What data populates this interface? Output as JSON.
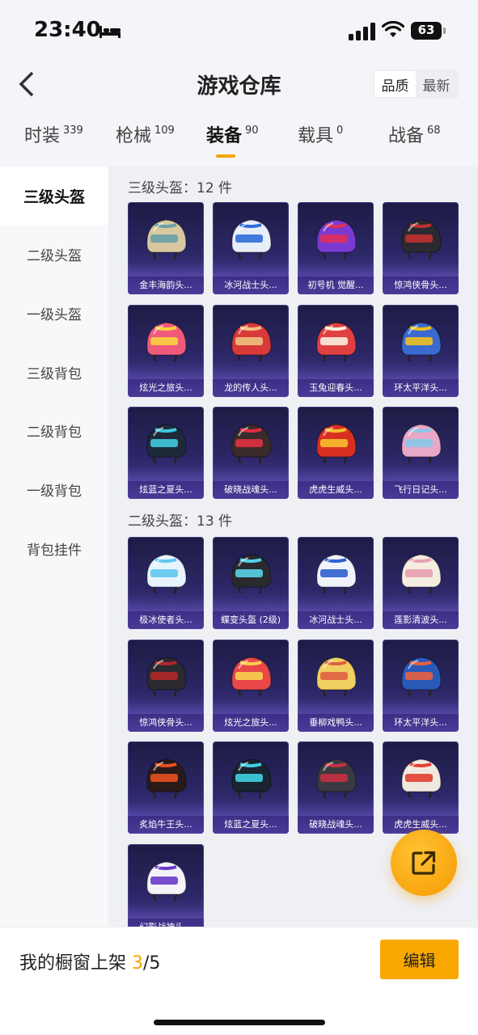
{
  "status": {
    "time": "23:40",
    "battery": "63"
  },
  "header": {
    "title": "游戏仓库",
    "sort_options": [
      "品质",
      "最新"
    ],
    "sort_active": 0
  },
  "tabs": [
    {
      "label": "时装",
      "count": "339"
    },
    {
      "label": "枪械",
      "count": "109"
    },
    {
      "label": "装备",
      "count": "90"
    },
    {
      "label": "载具",
      "count": "0"
    },
    {
      "label": "战备",
      "count": "68"
    }
  ],
  "active_tab": 2,
  "sidebar": [
    "三级头盔",
    "二级头盔",
    "一级头盔",
    "三级背包",
    "二级背包",
    "一级背包",
    "背包挂件"
  ],
  "sidebar_active": 0,
  "sections": [
    {
      "title": "三级头盔：12 件",
      "items": [
        {
          "name": "金丰海韵头...",
          "icon": "helmet-icon",
          "color": "#d8c8a0",
          "accent": "#6aa0a8"
        },
        {
          "name": "冰河战士头...",
          "icon": "helmet-icon",
          "color": "#e8eef8",
          "accent": "#2f6fd8"
        },
        {
          "name": "初号机 觉醒...",
          "icon": "helmet-icon",
          "color": "#7a3ad0",
          "accent": "#e0305a"
        },
        {
          "name": "惊鸿侠骨头...",
          "icon": "helmet-icon",
          "color": "#2a2a30",
          "accent": "#c03030"
        },
        {
          "name": "炫光之旅头...",
          "icon": "helmet-icon",
          "color": "#f05a7a",
          "accent": "#f8d040"
        },
        {
          "name": "龙的传人头...",
          "icon": "helmet-icon",
          "color": "#d83a3a",
          "accent": "#f0c080"
        },
        {
          "name": "玉兔迎春头...",
          "icon": "helmet-icon",
          "color": "#e04040",
          "accent": "#f8f0e0"
        },
        {
          "name": "环太平洋头...",
          "icon": "helmet-icon",
          "color": "#3a6ad0",
          "accent": "#f0c020"
        },
        {
          "name": "炫蓝之夏头...",
          "icon": "helmet-icon",
          "color": "#1e2a3a",
          "accent": "#40c8e0"
        },
        {
          "name": "破晓战魂头...",
          "icon": "helmet-icon",
          "color": "#3a2a2a",
          "accent": "#e03040"
        },
        {
          "name": "虎虎生威头...",
          "icon": "helmet-icon",
          "color": "#d83020",
          "accent": "#f8c030"
        },
        {
          "name": "飞行日记头...",
          "icon": "helmet-icon",
          "color": "#e8a8c8",
          "accent": "#88c8e8"
        }
      ]
    },
    {
      "title": "二级头盔：13 件",
      "items": [
        {
          "name": "极冰使者头...",
          "icon": "helmet-icon",
          "color": "#e8f4fc",
          "accent": "#60c8f0"
        },
        {
          "name": "蝶变头盔 (2级)",
          "icon": "helmet-icon",
          "color": "#2a2a2e",
          "accent": "#58d0e8"
        },
        {
          "name": "冰河战士头...",
          "icon": "helmet-icon",
          "color": "#f0f4fa",
          "accent": "#3060d0"
        },
        {
          "name": "莲影清波头...",
          "icon": "helmet-icon",
          "color": "#f4ede0",
          "accent": "#e8a0b0"
        },
        {
          "name": "惊鸿侠骨头...",
          "icon": "helmet-icon",
          "color": "#2a2a30",
          "accent": "#b02828"
        },
        {
          "name": "炫光之旅头...",
          "icon": "helmet-icon",
          "color": "#e84848",
          "accent": "#f8d050"
        },
        {
          "name": "垂柳戏鸭头...",
          "icon": "helmet-icon",
          "color": "#f0d060",
          "accent": "#e06040"
        },
        {
          "name": "环太平洋头...",
          "icon": "helmet-icon",
          "color": "#2a5ab8",
          "accent": "#e86040"
        },
        {
          "name": "炙焰牛王头...",
          "icon": "helmet-icon",
          "color": "#2a1a1a",
          "accent": "#e85020"
        },
        {
          "name": "炫蓝之夏头...",
          "icon": "helmet-icon",
          "color": "#1a2430",
          "accent": "#40d0e0"
        },
        {
          "name": "破晓战魂头...",
          "icon": "helmet-icon",
          "color": "#3a3a40",
          "accent": "#c83040"
        },
        {
          "name": "虎虎生威头...",
          "icon": "helmet-icon",
          "color": "#f0e8e0",
          "accent": "#e04030"
        },
        {
          "name": "幻影战神头...",
          "icon": "helmet-icon",
          "color": "#f4f4f8",
          "accent": "#6a3ac8"
        }
      ]
    }
  ],
  "bottom_bar": {
    "prefix": "我的橱窗上架 ",
    "count": "3",
    "total": "/5",
    "edit_label": "编辑"
  },
  "colors": {
    "accent": "#f8a800",
    "card_top": "#1d1b44",
    "card_bottom": "#4a3ea0"
  }
}
